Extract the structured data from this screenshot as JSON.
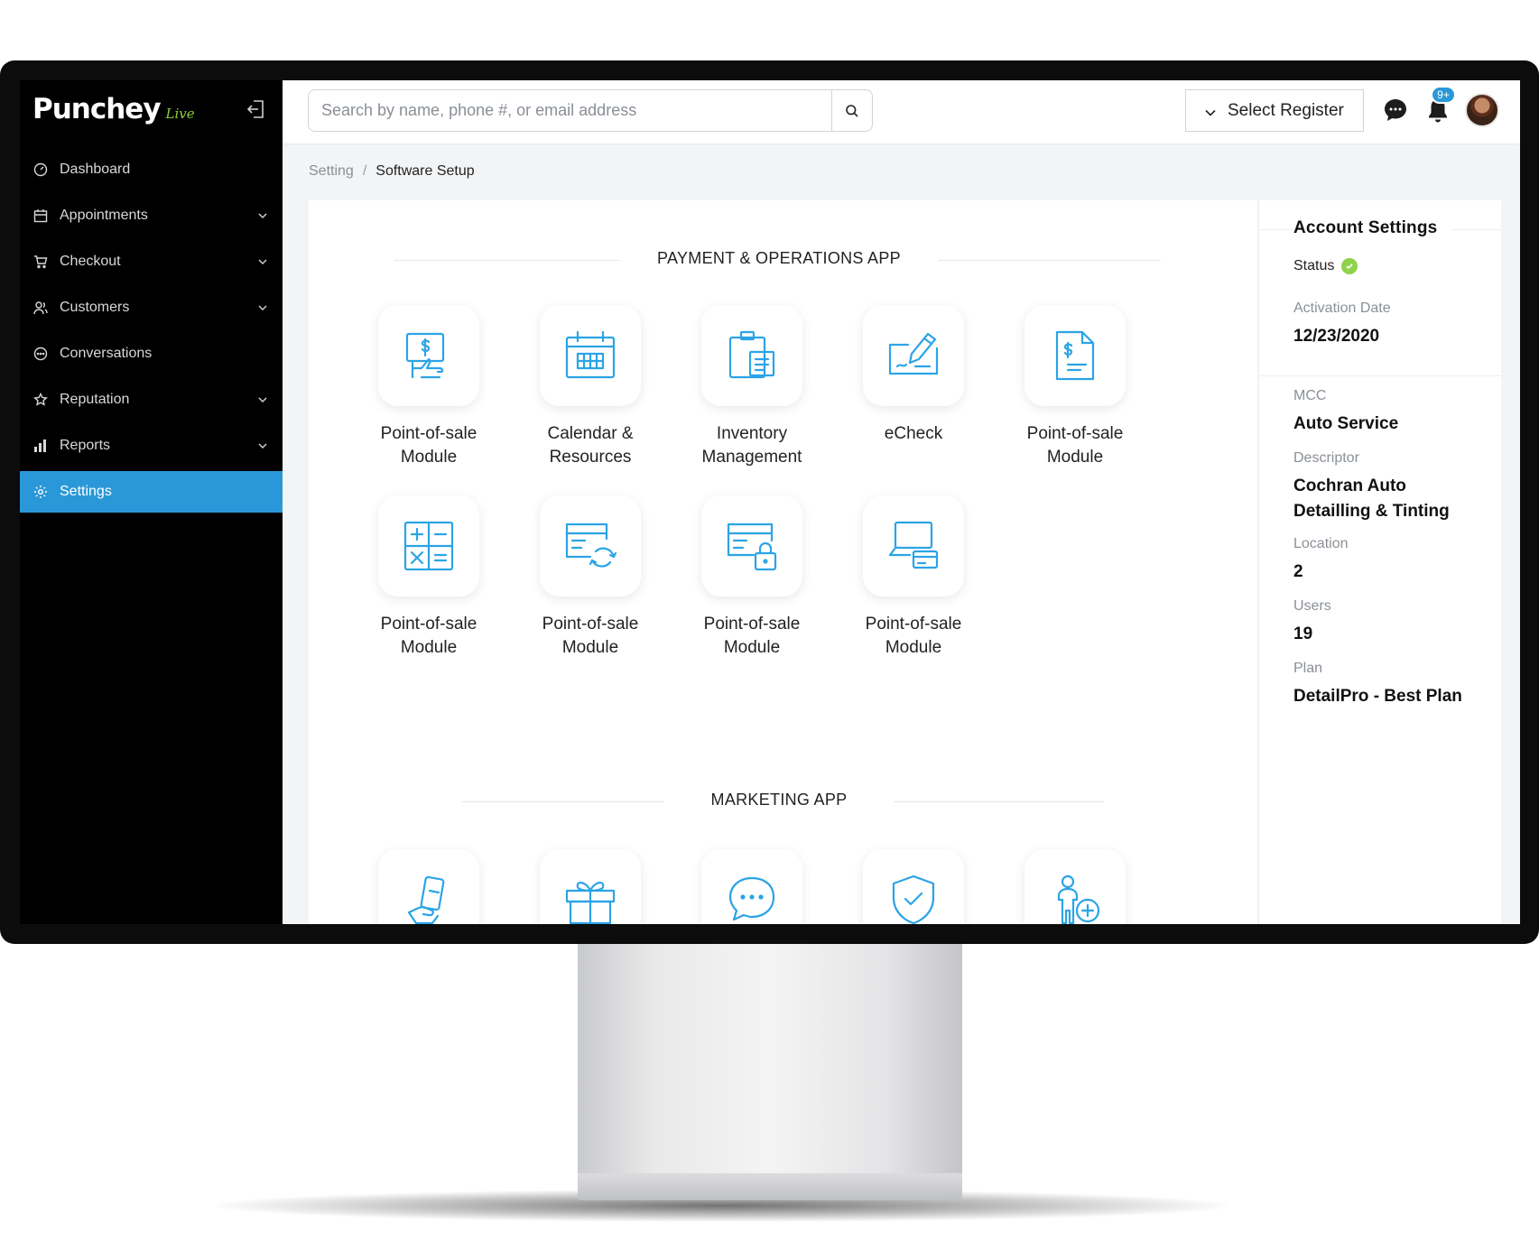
{
  "app": {
    "brand": "Punchey",
    "brand_suffix": "Live"
  },
  "sidebar": {
    "items": [
      {
        "label": "Dashboard",
        "icon": "gauge-icon",
        "has_chevron": false,
        "active": false
      },
      {
        "label": "Appointments",
        "icon": "calendar-icon",
        "has_chevron": true,
        "active": false
      },
      {
        "label": "Checkout",
        "icon": "cart-icon",
        "has_chevron": true,
        "active": false
      },
      {
        "label": "Customers",
        "icon": "users-icon",
        "has_chevron": true,
        "active": false
      },
      {
        "label": "Conversations",
        "icon": "chat-icon",
        "has_chevron": false,
        "active": false
      },
      {
        "label": "Reputation",
        "icon": "star-icon",
        "has_chevron": true,
        "active": false
      },
      {
        "label": "Reports",
        "icon": "bar-chart-icon",
        "has_chevron": true,
        "active": false
      },
      {
        "label": "Settings",
        "icon": "gear-icon",
        "has_chevron": false,
        "active": true
      }
    ]
  },
  "topbar": {
    "search_placeholder": "Search by name, phone #, or email address",
    "register_label": "Select Register",
    "notification_count": "9+"
  },
  "breadcrumb": {
    "parent": "Setting",
    "separator": "/",
    "current": "Software Setup"
  },
  "sections": {
    "payment": {
      "title": "PAYMENT & OPERATIONS APP",
      "tiles": [
        {
          "label_1": "Point-of-sale",
          "label_2": "Module",
          "icon": "pos-payment-icon"
        },
        {
          "label_1": "Calendar &",
          "label_2": "Resources",
          "icon": "calendar-grid-icon"
        },
        {
          "label_1": "Inventory",
          "label_2": "Management",
          "icon": "clipboard-icon"
        },
        {
          "label_1": "eCheck",
          "label_2": "",
          "icon": "check-sign-icon"
        },
        {
          "label_1": "Point-of-sale",
          "label_2": "Module",
          "icon": "invoice-icon"
        },
        {
          "label_1": "Point-of-sale",
          "label_2": "Module",
          "icon": "calculator-icon"
        },
        {
          "label_1": "Point-of-sale",
          "label_2": "Module",
          "icon": "card-sync-icon"
        },
        {
          "label_1": "Point-of-sale",
          "label_2": "Module",
          "icon": "card-lock-icon"
        },
        {
          "label_1": "Point-of-sale",
          "label_2": "Module",
          "icon": "devices-card-icon"
        }
      ]
    },
    "marketing": {
      "title": "MARKETING APP",
      "tiles": [
        {
          "icon": "phone-hand-icon"
        },
        {
          "icon": "gift-icon"
        },
        {
          "icon": "chat-bubble-icon"
        },
        {
          "icon": "shield-check-icon"
        },
        {
          "icon": "user-add-icon"
        }
      ]
    }
  },
  "account": {
    "title": "Account Settings",
    "status_label": "Status",
    "status_color": "#8fd34a",
    "activation_date_label": "Activation Date",
    "activation_date": "12/23/2020",
    "mcc_label": "MCC",
    "mcc": "Auto Service",
    "descriptor_label": "Descriptor",
    "descriptor": "Cochran Auto Detailling & Tinting",
    "location_label": "Location",
    "location": "2",
    "users_label": "Users",
    "users": "19",
    "plan_label": "Plan",
    "plan": "DetailPro - Best Plan"
  },
  "colors": {
    "accent": "#2a98d8",
    "icon_blue": "#2ba4e6",
    "sidebar_bg": "#000000"
  }
}
